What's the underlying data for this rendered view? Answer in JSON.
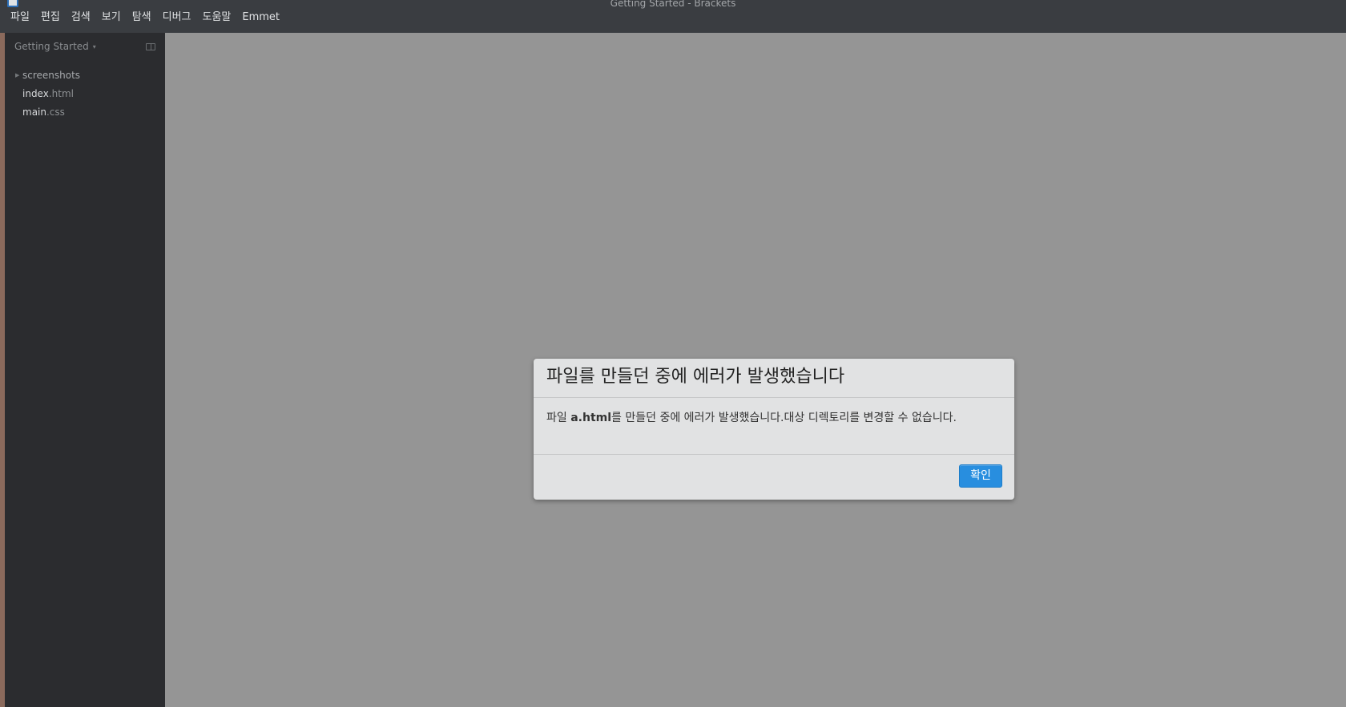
{
  "window": {
    "title": "Getting Started - Brackets"
  },
  "menubar": {
    "items": [
      "파일",
      "편집",
      "검색",
      "보기",
      "탐색",
      "디버그",
      "도움말",
      "Emmet"
    ]
  },
  "sidebar": {
    "project_title": "Getting Started",
    "project_caret": "▾",
    "tree": [
      {
        "kind": "folder",
        "name": "screenshots",
        "ext": "",
        "arrow": "▶"
      },
      {
        "kind": "file",
        "name": "index",
        "ext": ".html"
      },
      {
        "kind": "file",
        "name": "main",
        "ext": ".css"
      }
    ]
  },
  "dialog": {
    "title": "파일를 만들던 중에 에러가 발생했습니다",
    "message_prefix": "파일 ",
    "message_filename": "a.html",
    "message_suffix": "를 만들던 중에 에러가 발생했습니다.대상 디렉토리를 변경할 수 없습니다.",
    "ok_label": "확인"
  },
  "colors": {
    "titlebar": "#3a3d41",
    "sidebar": "#2b2c2f",
    "editor_overlay": "#959595",
    "dialog_bg": "#e1e2e3",
    "primary_button": "#288edf"
  }
}
